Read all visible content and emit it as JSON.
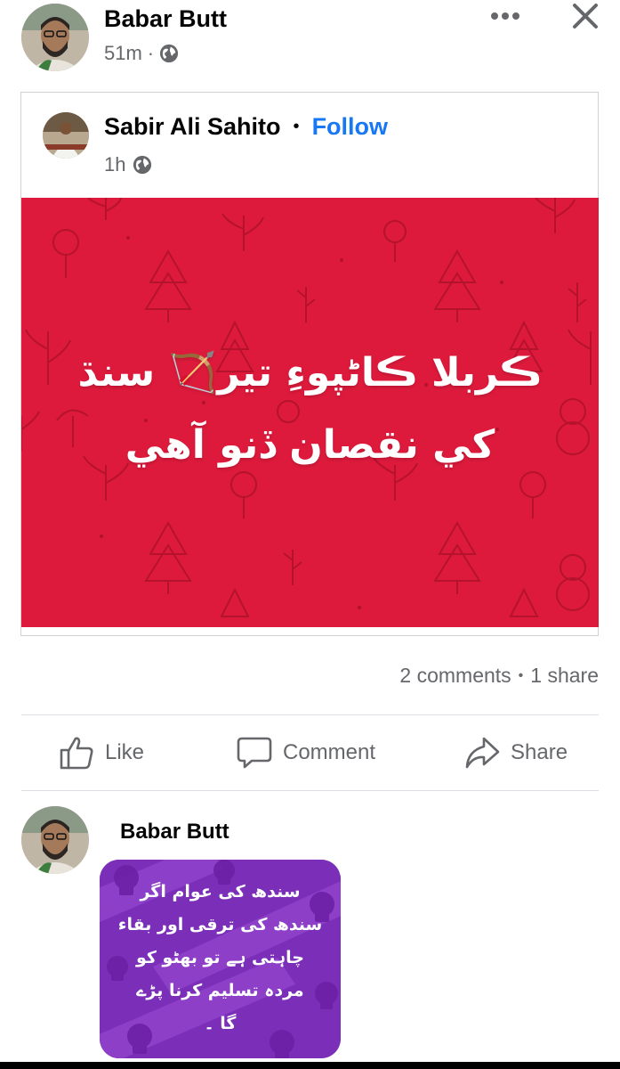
{
  "post": {
    "author": "Babar Butt",
    "time": "51m",
    "separator": "·",
    "more_icon": "more-horizontal-icon",
    "close_icon": "close-icon"
  },
  "shared": {
    "author": "Sabir Ali Sahito",
    "dot": "•",
    "follow_label": "Follow",
    "time": "1h",
    "banner_line1": "ڪربلا ڪاڻپوءِ تير🏹 سنڌ",
    "banner_line2": "کي نقصان ڏنو آهي",
    "banner_color": "#dd1a3c"
  },
  "stats": {
    "comments": "2 comments",
    "separator": "•",
    "shares": "1 share"
  },
  "actions": {
    "like": "Like",
    "comment": "Comment",
    "share": "Share"
  },
  "comment": {
    "author": "Babar Butt",
    "text": "سندھ کی عوام اگر\nسندھ کی ترقی اور بقاء\nچاہتی ہے تو بھٹو کو\nمردہ تسلیم کرنا پڑے\nگا ۔",
    "bubble_color": "#7b2fb8"
  },
  "colors": {
    "accent": "#1877f2",
    "muted": "#65676b"
  }
}
